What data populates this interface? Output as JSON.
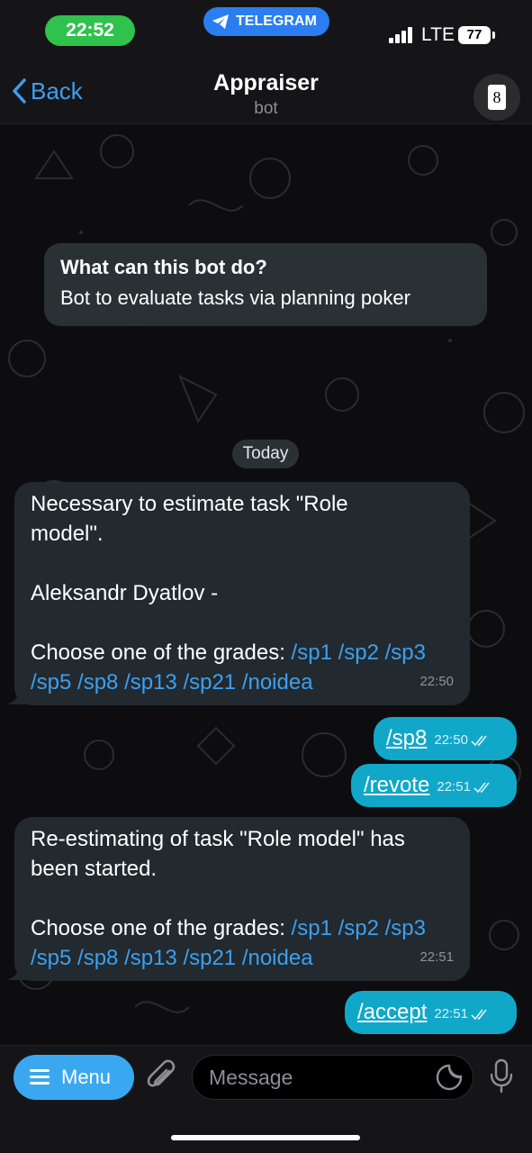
{
  "status_bar": {
    "time": "22:52",
    "app_pill": "TELEGRAM",
    "network": "LTE",
    "battery": "77"
  },
  "header": {
    "back_label": "Back",
    "title": "Appraiser",
    "subtitle": "bot",
    "avatar_card": "8"
  },
  "intro": {
    "title": "What can this bot do?",
    "text": "Bot to evaluate tasks via planning poker"
  },
  "date_label": "Today",
  "messages": {
    "m1": {
      "line1": "Necessary to estimate task \"Role",
      "line2": "model\".",
      "line3": "Aleksandr Dyatlov -",
      "line4_prefix": "Choose one of the grades: ",
      "line4_cmds": "/sp1 /sp2 /sp3",
      "line5_cmds": "/sp5 /sp8 /sp13 /sp21 /noidea",
      "time": "22:50"
    },
    "o1": {
      "text": "/sp8",
      "time": "22:50"
    },
    "o2": {
      "text": "/revote",
      "time": "22:51"
    },
    "m2": {
      "line1": "Re-estimating of task \"Role model\" has",
      "line2": "been started.",
      "line3_prefix": "Choose one of the grades: ",
      "line3_cmds": "/sp1 /sp2 /sp3",
      "line4_cmds": "/sp5 /sp8 /sp13 /sp21 /noidea",
      "time": "22:51"
    },
    "o3": {
      "text": "/accept",
      "time": "22:51"
    }
  },
  "composer": {
    "menu_label": "Menu",
    "placeholder": "Message"
  },
  "colors": {
    "accent": "#3d9ff0",
    "outgoing_bubble": "#11a7c8",
    "incoming_bubble": "#222a2f",
    "time_pill": "#2fc24c"
  }
}
